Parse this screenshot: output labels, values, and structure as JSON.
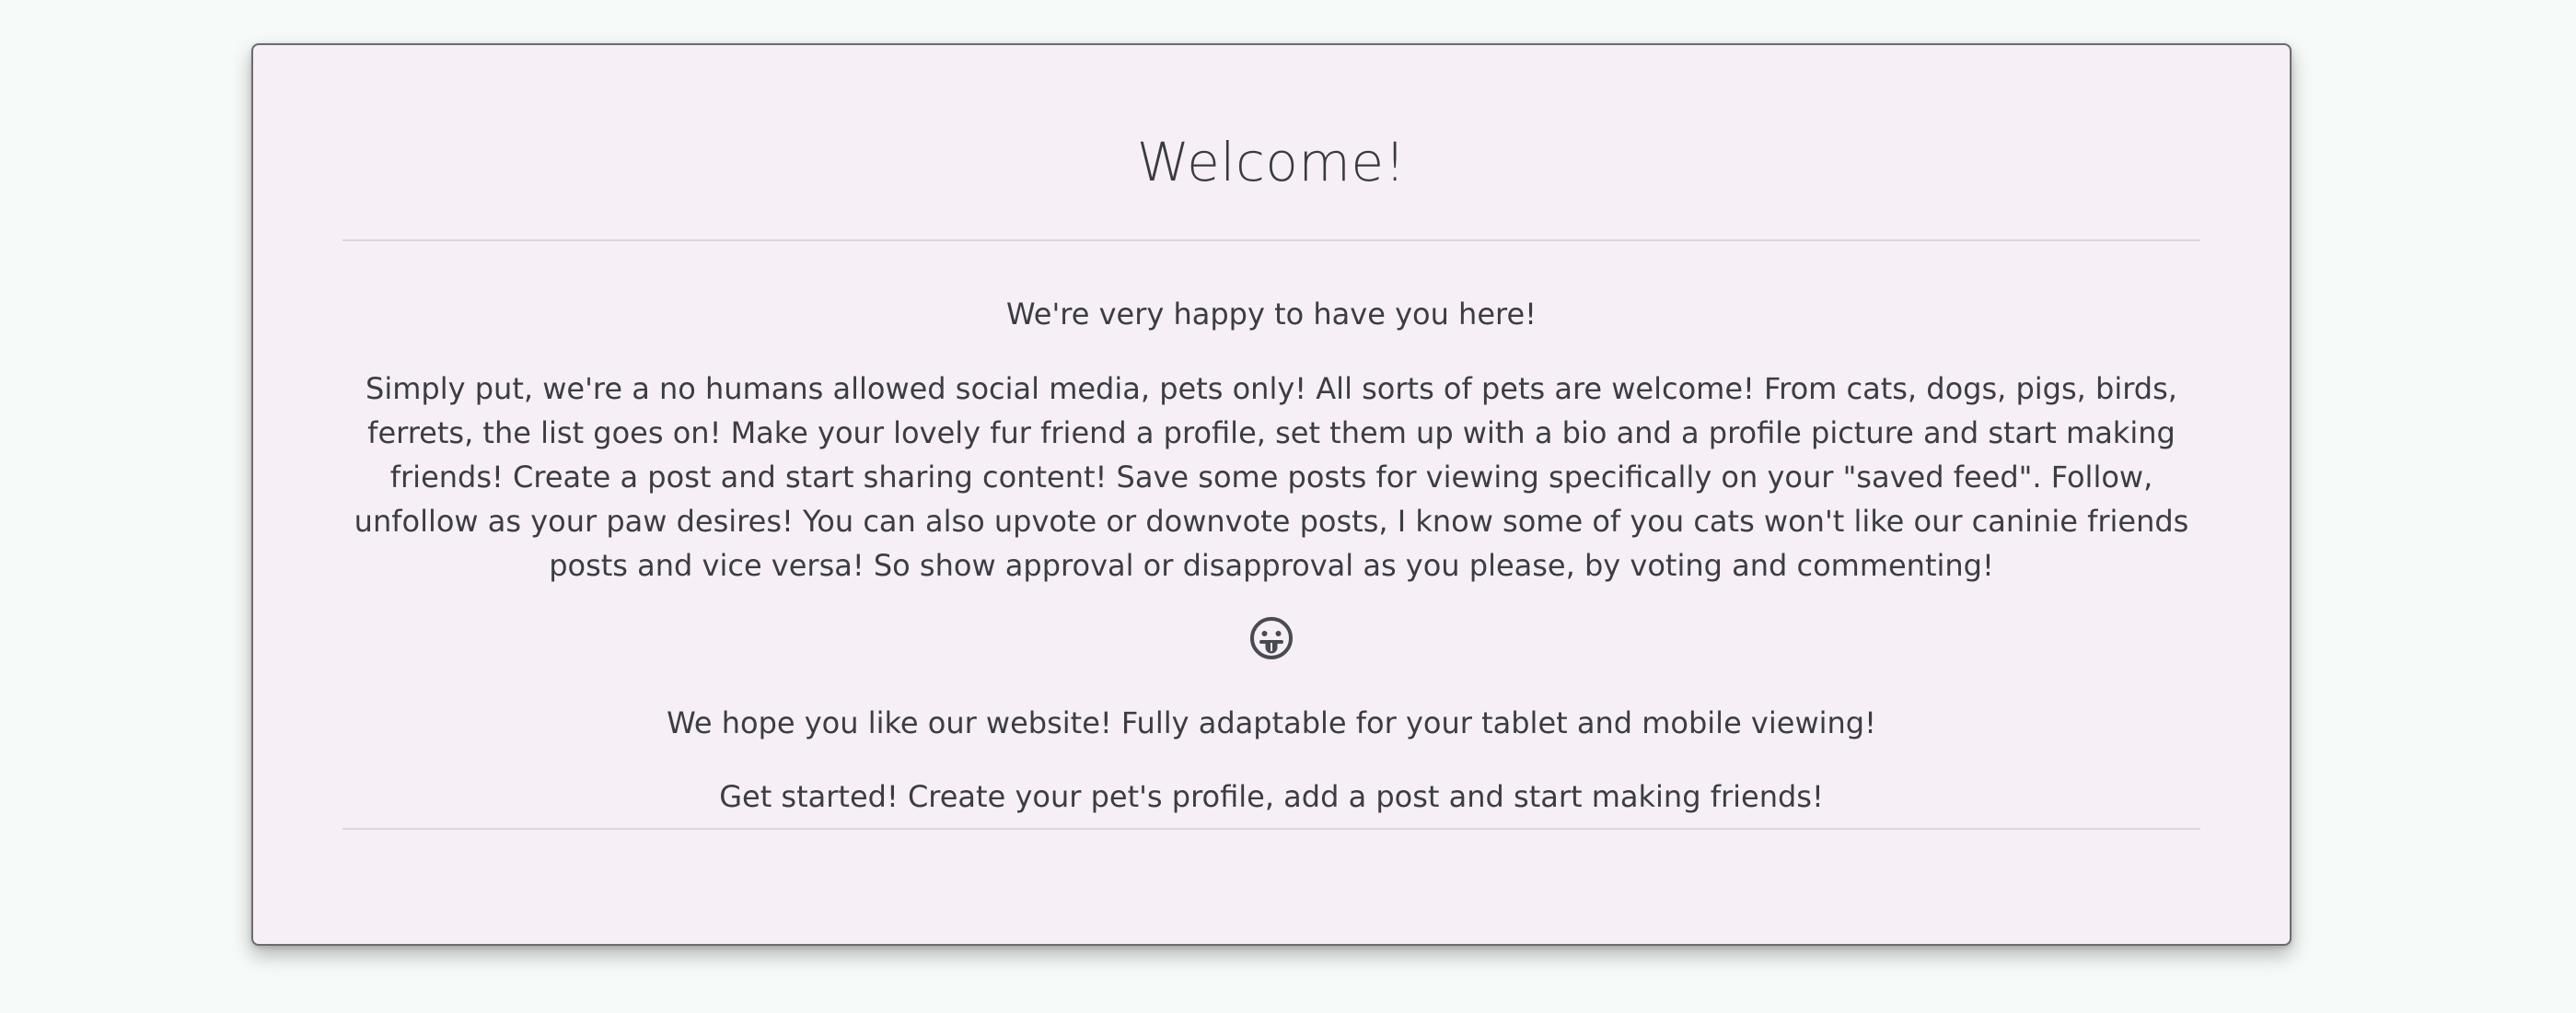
{
  "welcome": {
    "title": "Welcome!",
    "lead": "We're very happy to have you here!",
    "description": "Simply put, we're a no humans allowed social media, pets only! All sorts of pets are welcome! From cats, dogs, pigs, birds, ferrets, the list goes on! Make your lovely fur friend a profile, set them up with a bio and a profile picture and start making friends! Create a post and start sharing content! Save some posts for viewing specifically on your \"saved feed\". Follow, unfollow as your paw desires! You can also upvote or downvote posts, I know some of you cats won't like our caninie friends posts and vice versa! So show approval or disapproval as you please, by voting and commenting!",
    "emoji_icon": "face-with-tongue-icon",
    "hope": "We hope you like our website! Fully adaptable for your tablet and mobile viewing!",
    "get_started": "Get started! Create your pet's profile, add a post and start making friends!"
  }
}
